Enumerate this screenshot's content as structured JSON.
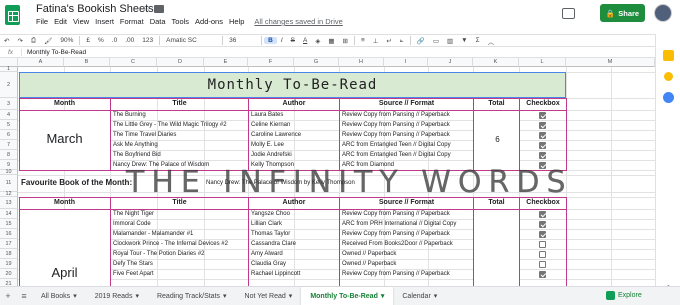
{
  "app": {
    "doc_title": "Fatina's Bookish Sheets",
    "menu": [
      "File",
      "Edit",
      "View",
      "Insert",
      "Format",
      "Data",
      "Tools",
      "Add-ons",
      "Help"
    ],
    "saved_status": "All changes saved in Drive",
    "share_label": "Share"
  },
  "toolbar": {
    "zoom": "90%",
    "currency": "£",
    "percent": "%",
    "dec_less": ".0",
    "dec_more": ".00",
    "format": "123",
    "font": "Amatic SC",
    "font_size": "36",
    "bold": "B",
    "italic": "I",
    "strike": "S",
    "textcolor": "A"
  },
  "formula_bar": {
    "fx": "fx",
    "value": "Monthly To-Be-Read"
  },
  "columns": [
    "A",
    "B",
    "C",
    "D",
    "E",
    "F",
    "G",
    "H",
    "I",
    "J",
    "K",
    "L",
    "M"
  ],
  "rows": [
    "1",
    "2",
    "3",
    "4",
    "5",
    "6",
    "7",
    "8",
    "9",
    "10",
    "11",
    "12",
    "13",
    "14",
    "15",
    "16",
    "17",
    "18",
    "19",
    "20",
    "21"
  ],
  "sheet": {
    "banner": "Monthly To-Be-Read",
    "headers": {
      "month": "Month",
      "title": "Title",
      "author": "Author",
      "source": "Source // Format",
      "total": "Total",
      "checkbox": "Checkbox"
    },
    "march": {
      "month": "March",
      "total": "6",
      "books": [
        {
          "title": "The Burning",
          "author": "Laura Bates",
          "source": "Review Copy from Pansing // Paperback",
          "checked": true
        },
        {
          "title": "The Little Grey - The Wild Magic Trilogy #2",
          "author": "Celine Kiernan",
          "source": "Review Copy from Pansing // Paperback",
          "checked": true
        },
        {
          "title": "The Time Travel Diaries",
          "author": "Caroline Lawrence",
          "source": "Review Copy from Pansing // Paperback",
          "checked": true
        },
        {
          "title": "Ask Me Anything",
          "author": "Molly E. Lee",
          "source": "ARC from Entangled Teen // Digital Copy",
          "checked": true
        },
        {
          "title": "The Boyfriend Bid",
          "author": "Jodie Andrefski",
          "source": "ARC from Entangled Teen // Digital Copy",
          "checked": true
        },
        {
          "title": "Nancy Drew: The Palace of Wisdom",
          "author": "Kelly Thompson",
          "source": "ARC from Diamond",
          "checked": true
        }
      ]
    },
    "favourite": {
      "label": "Favourite Book of the Month:",
      "value": "Nancy Drew: The Palace of Wisdom by Kelly Thompson"
    },
    "april": {
      "month": "April",
      "books": [
        {
          "title": "The Night Tiger",
          "author": "Yangsze Choo",
          "source": "Review Copy from Pansing // Paperback",
          "checked": true
        },
        {
          "title": "Immoral Code",
          "author": "Lillian Clark",
          "source": "ARC from PRH International // Digital Copy",
          "checked": true
        },
        {
          "title": "Malamander - Malamander #1",
          "author": "Thomas Taylor",
          "source": "Review Copy from Pansing // Paperback",
          "checked": true
        },
        {
          "title": "Clockwork Prince - The Infernal Devices #2",
          "author": "Cassandra Clare",
          "source": "Received From Books2Door // Paperback",
          "checked": false
        },
        {
          "title": "Royal Tour - The Potion Diaries #2",
          "author": "Amy Alward",
          "source": "Owned // Paperback",
          "checked": false
        },
        {
          "title": "Defy The Stars",
          "author": "Claudia Gray",
          "source": "Owned // Paperback",
          "checked": false
        },
        {
          "title": "Five Feet Apart",
          "author": "Rachael Lippincott",
          "source": "Review Copy from Pansing // Paperback",
          "checked": true
        }
      ]
    },
    "watermark": "THE INFINITY WORDS"
  },
  "tabs": {
    "add": "+",
    "list": "≡",
    "items": [
      "All Books",
      "2019 Reads",
      "Reading Track/Stats",
      "Not Yet Read",
      "Monthly To-Be-Read",
      "Calendar"
    ],
    "active": "Monthly To-Be-Read",
    "explore": "Explore"
  },
  "colors": {
    "brand": "#0f9d58",
    "share": "#1e8e3e",
    "banner": "#d9ead3",
    "section_border": "#c0398a",
    "selection": "#4a86e8"
  }
}
